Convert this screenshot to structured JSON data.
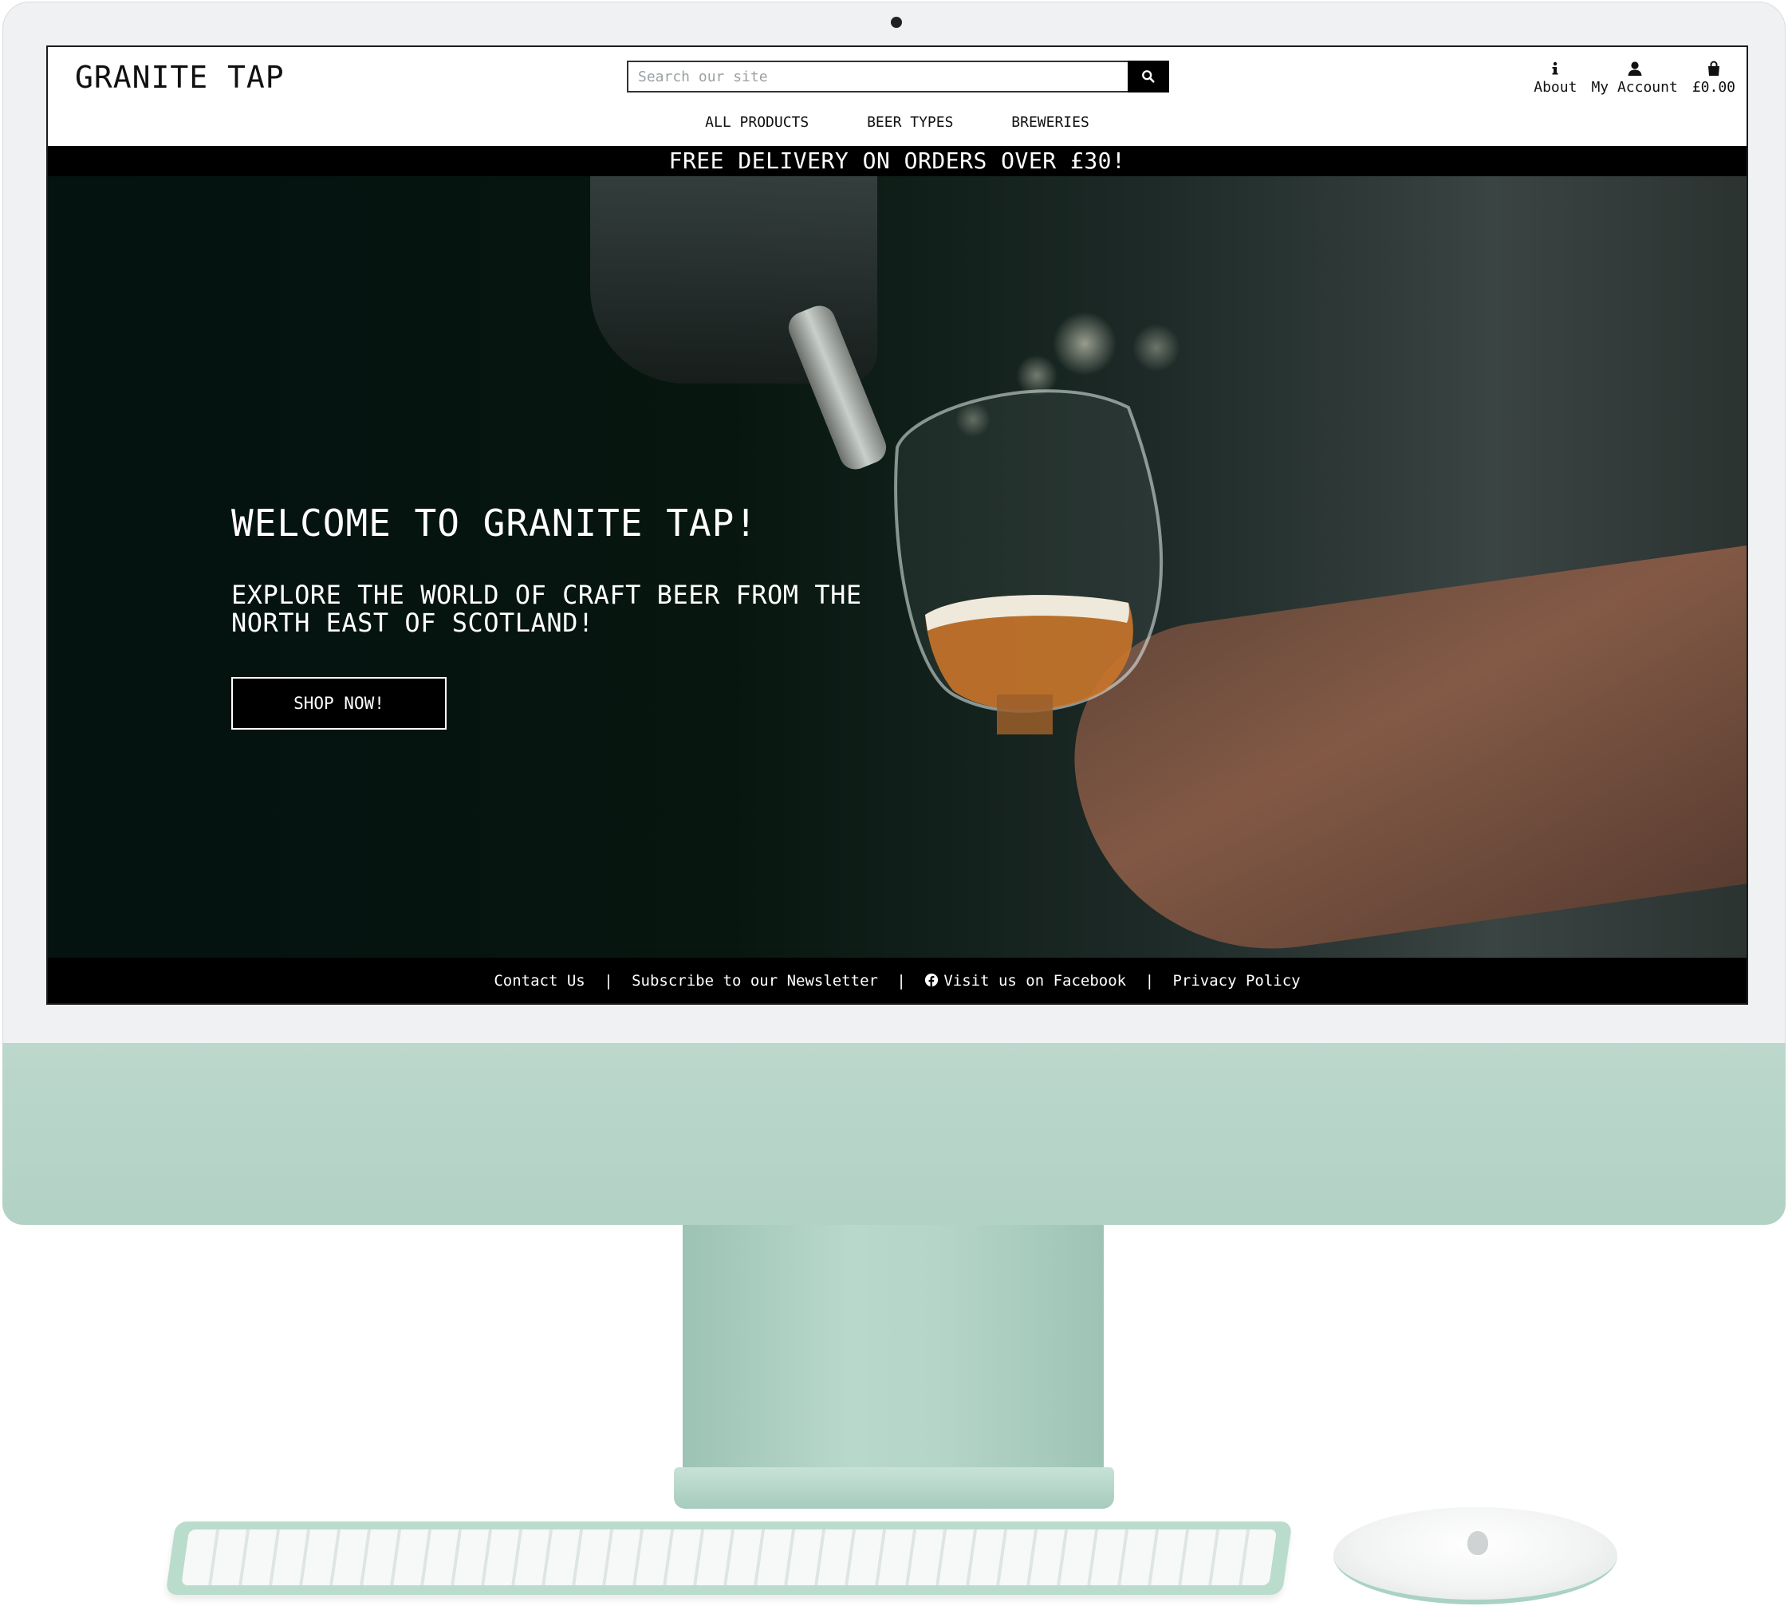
{
  "header": {
    "logo": "GRANITE TAP",
    "search": {
      "placeholder": "Search our site",
      "value": ""
    },
    "nav": [
      "ALL PRODUCTS",
      "BEER TYPES",
      "BREWERIES"
    ],
    "user_links": {
      "about": {
        "label": "About",
        "icon": "info-icon"
      },
      "account": {
        "label": "My Account",
        "icon": "user-icon"
      },
      "bag": {
        "label": "£0.00",
        "icon": "shopping-bag-icon"
      }
    }
  },
  "banner": {
    "text": "FREE DELIVERY ON ORDERS OVER £30!"
  },
  "hero": {
    "title": "WELCOME TO GRANITE TAP!",
    "subtitle": "EXPLORE THE WORLD OF CRAFT BEER FROM THE NORTH EAST OF SCOTLAND!",
    "cta": "SHOP NOW!"
  },
  "footer": {
    "contact": "Contact Us",
    "newsletter": "Subscribe to our Newsletter",
    "facebook": "Visit us on Facebook",
    "privacy": "Privacy Policy",
    "separator": "|"
  },
  "colors": {
    "device_accent": "#b5d5c8",
    "bezel": "#eff1f2",
    "banner_bg": "#000000",
    "text_dark": "#111111"
  }
}
